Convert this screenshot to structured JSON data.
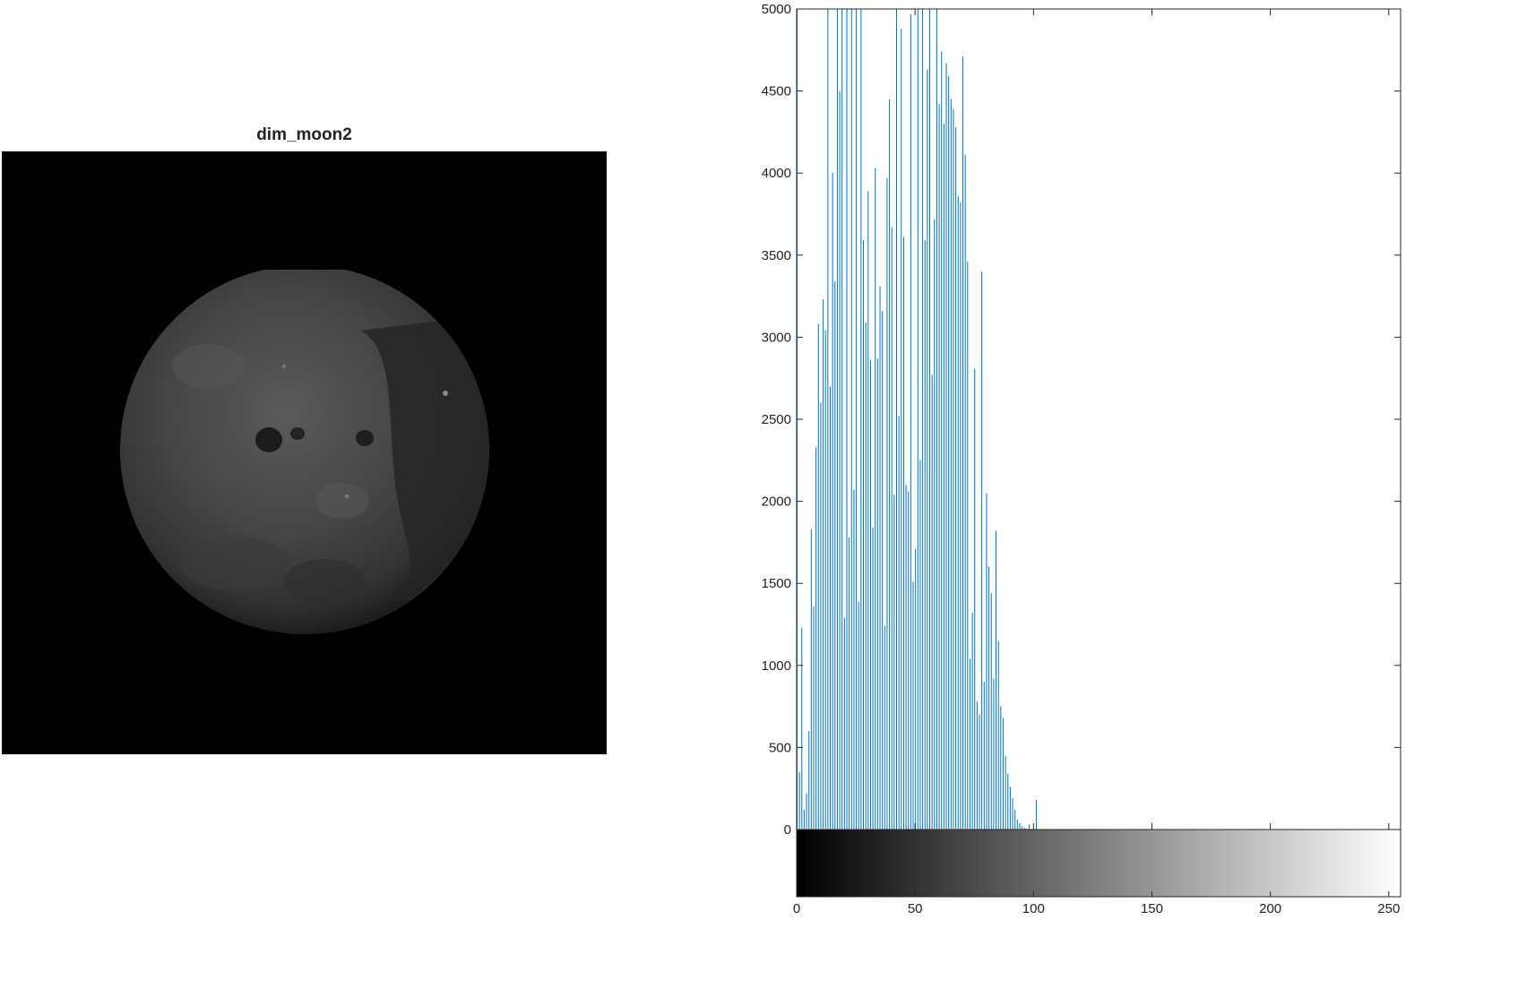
{
  "image": {
    "title": "dim_moon2"
  },
  "chart_data": {
    "type": "bar",
    "xlim": [
      0,
      255
    ],
    "ylim": [
      0,
      5000
    ],
    "x_ticks": [
      0,
      50,
      100,
      150,
      200,
      250
    ],
    "y_ticks": [
      0,
      500,
      1000,
      1500,
      2000,
      2500,
      3000,
      3500,
      4000,
      4500,
      5000
    ],
    "grid": false,
    "colorbar": "grayscale 0-255",
    "bar_color": "#0072BD",
    "x": [
      0,
      1,
      2,
      3,
      4,
      5,
      6,
      7,
      8,
      9,
      10,
      11,
      12,
      13,
      14,
      15,
      16,
      17,
      18,
      19,
      20,
      21,
      22,
      23,
      24,
      25,
      26,
      27,
      28,
      29,
      30,
      31,
      32,
      33,
      34,
      35,
      36,
      37,
      38,
      39,
      40,
      41,
      42,
      43,
      44,
      45,
      46,
      47,
      48,
      49,
      50,
      51,
      52,
      53,
      54,
      55,
      56,
      57,
      58,
      59,
      60,
      61,
      62,
      63,
      64,
      65,
      66,
      67,
      68,
      69,
      70,
      71,
      72,
      73,
      74,
      75,
      76,
      77,
      78,
      79,
      80,
      81,
      82,
      83,
      84,
      85,
      86,
      87,
      88,
      89,
      90,
      91,
      92,
      93,
      94,
      95,
      96,
      97,
      98,
      99,
      100,
      101,
      102
    ],
    "values": [
      5000,
      350,
      1230,
      120,
      220,
      600,
      1830,
      1360,
      2330,
      3080,
      2600,
      3230,
      3040,
      5000,
      2700,
      4000,
      3340,
      5000,
      4500,
      5000,
      1290,
      5000,
      1780,
      5000,
      2070,
      5000,
      1390,
      5000,
      3590,
      3090,
      3890,
      2860,
      1840,
      4030,
      2870,
      3310,
      3160,
      1240,
      3970,
      4450,
      3670,
      2040,
      5000,
      2520,
      4880,
      3610,
      2100,
      2060,
      4970,
      1510,
      1710,
      5000,
      2250,
      5000,
      3590,
      4630,
      5000,
      2770,
      3720,
      5000,
      4420,
      4740,
      4300,
      4670,
      4590,
      4450,
      4390,
      4280,
      3860,
      3820,
      4710,
      4110,
      3460,
      1040,
      1320,
      2810,
      780,
      700,
      3400,
      900,
      2050,
      1600,
      1440,
      920,
      1820,
      1150,
      750,
      680,
      450,
      340,
      260,
      190,
      120,
      60,
      40,
      20,
      10,
      5,
      30,
      0,
      0,
      180,
      0
    ]
  }
}
